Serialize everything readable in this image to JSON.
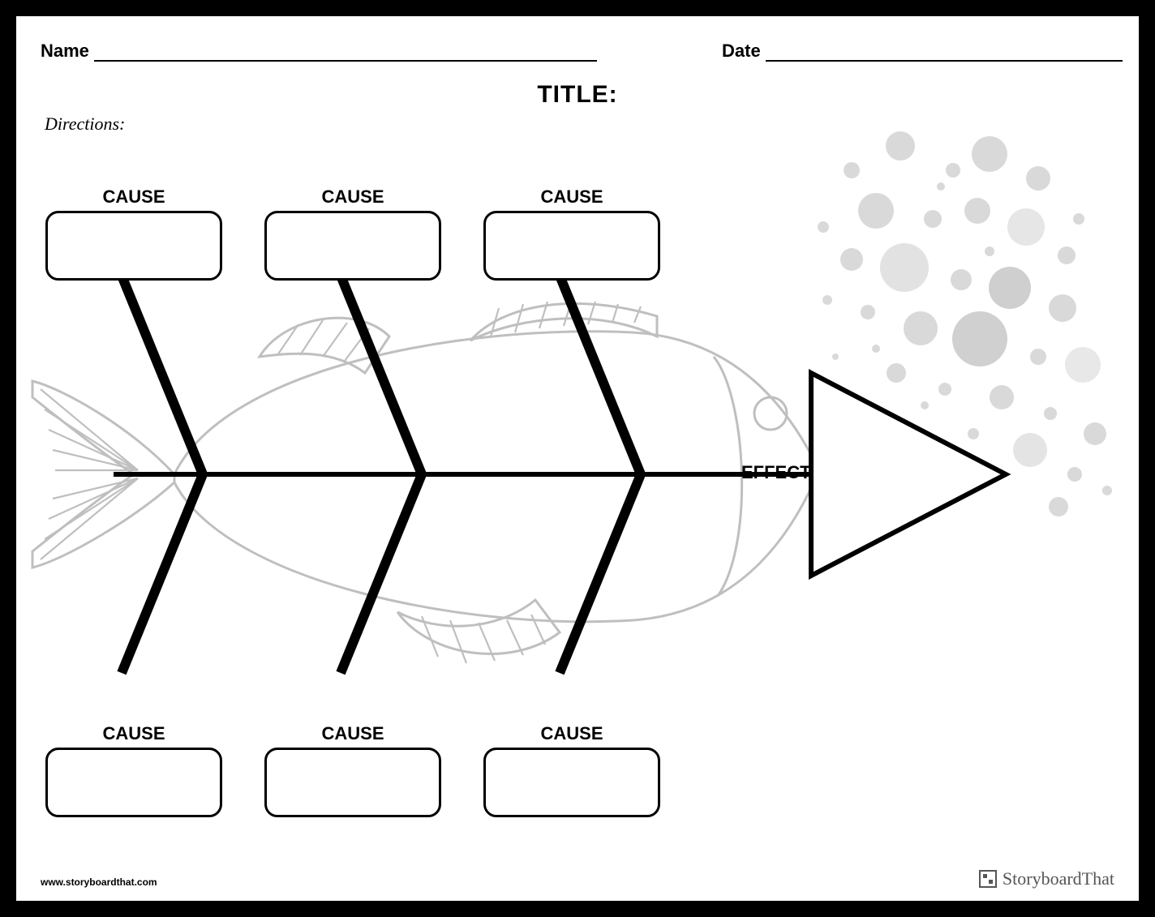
{
  "header": {
    "name_label": "Name",
    "date_label": "Date",
    "title_label": "TITLE:",
    "directions_label": "Directions:"
  },
  "diagram": {
    "type": "fishbone",
    "effect_label": "EFFECT:",
    "causes_top": [
      {
        "label": "CAUSE"
      },
      {
        "label": "CAUSE"
      },
      {
        "label": "CAUSE"
      }
    ],
    "causes_bottom": [
      {
        "label": "CAUSE"
      },
      {
        "label": "CAUSE"
      },
      {
        "label": "CAUSE"
      }
    ]
  },
  "footer": {
    "url": "www.storyboardthat.com",
    "brand": "StoryboardThat"
  }
}
